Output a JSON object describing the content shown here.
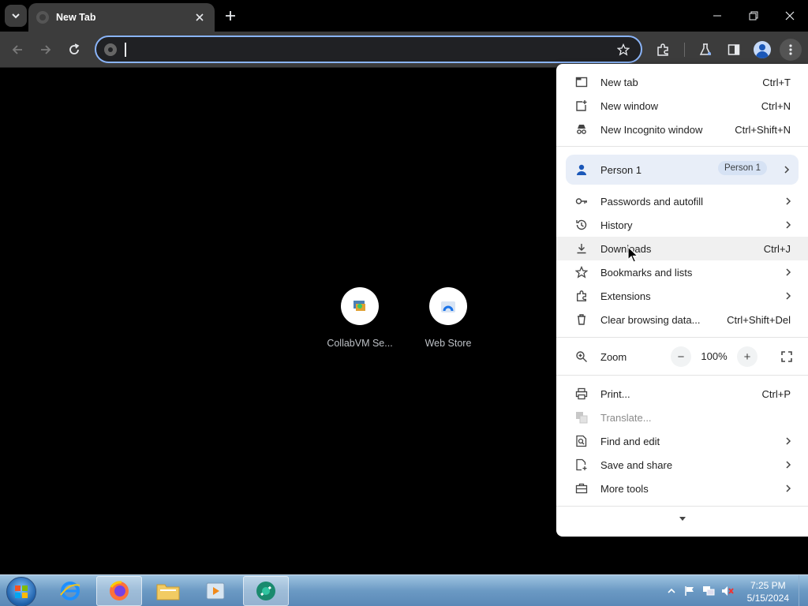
{
  "browser": {
    "tab": {
      "title": "New Tab"
    },
    "omnibox": {
      "value": "",
      "placeholder": ""
    }
  },
  "new_tab_page": {
    "shortcuts": [
      {
        "label": "CollabVM Se..."
      },
      {
        "label": "Web Store"
      }
    ]
  },
  "menu": {
    "new_tab": {
      "label": "New tab",
      "shortcut": "Ctrl+T"
    },
    "new_window": {
      "label": "New window",
      "shortcut": "Ctrl+N"
    },
    "new_incognito": {
      "label": "New Incognito window",
      "shortcut": "Ctrl+Shift+N"
    },
    "profile": {
      "label": "Person 1",
      "badge": "Person 1"
    },
    "passwords": {
      "label": "Passwords and autofill"
    },
    "history": {
      "label": "History"
    },
    "downloads": {
      "label": "Downloads",
      "shortcut": "Ctrl+J"
    },
    "bookmarks": {
      "label": "Bookmarks and lists"
    },
    "extensions": {
      "label": "Extensions"
    },
    "clear_data": {
      "label": "Clear browsing data...",
      "shortcut": "Ctrl+Shift+Del"
    },
    "zoom": {
      "label": "Zoom",
      "value": "100%",
      "minus": "−",
      "plus": "+"
    },
    "print": {
      "label": "Print...",
      "shortcut": "Ctrl+P"
    },
    "translate": {
      "label": "Translate..."
    },
    "find_edit": {
      "label": "Find and edit"
    },
    "save_share": {
      "label": "Save and share"
    },
    "more_tools": {
      "label": "More tools"
    }
  },
  "taskbar": {
    "time": "7:25 PM",
    "date": "5/15/2024"
  },
  "colors": {
    "omnibox_focus": "#8ab4f8",
    "toolbar": "#3c3c3c",
    "menu_bg": "#ffffff",
    "profile_row": "#e8eef8"
  }
}
